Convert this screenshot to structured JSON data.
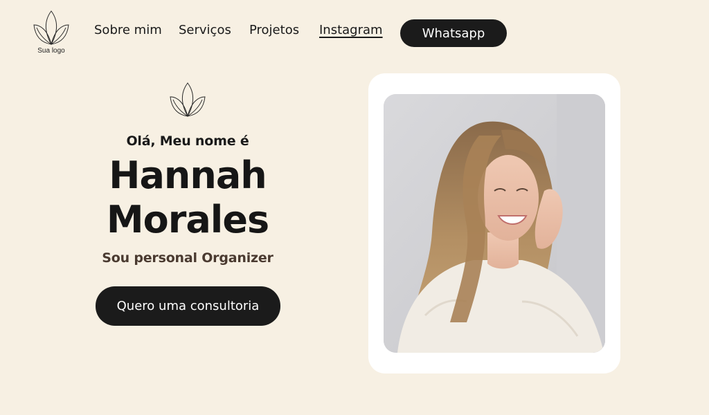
{
  "header": {
    "logo_text": "Sua logo",
    "nav": [
      {
        "label": "Sobre mim",
        "active": false
      },
      {
        "label": "Serviços",
        "active": false
      },
      {
        "label": "Projetos",
        "active": false
      },
      {
        "label": "Instagram",
        "active": true
      }
    ],
    "whatsapp_label": "Whatsapp"
  },
  "hero": {
    "greeting": "Olá, Meu nome é",
    "name_line1": "Hannah",
    "name_line2": "Morales",
    "role": "Sou personal Organizer",
    "cta_label": "Quero uma consultoria"
  },
  "photo": {
    "icon": "portrait-photo"
  },
  "colors": {
    "background": "#f7f0e3",
    "button": "#1b1b1b",
    "button_text": "#ffffff",
    "card": "#ffffff",
    "role_text": "#4a3a30"
  }
}
